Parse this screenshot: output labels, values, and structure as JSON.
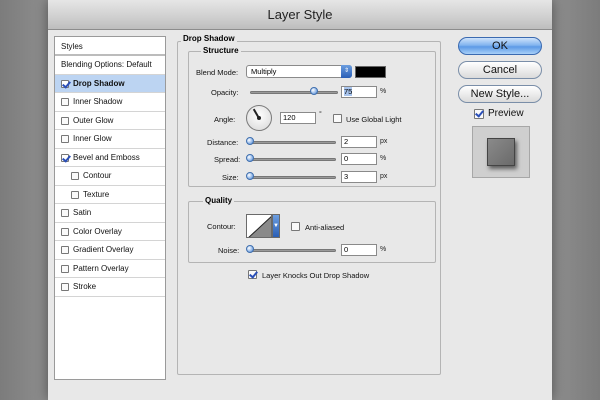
{
  "window": {
    "title": "Layer Style"
  },
  "styles_panel": {
    "header": "Styles",
    "items": [
      {
        "label": "Blending Options: Default",
        "checkbox": false,
        "checked": false,
        "indent": 0,
        "selected": false
      },
      {
        "label": "Drop Shadow",
        "checkbox": true,
        "checked": true,
        "indent": 0,
        "selected": true
      },
      {
        "label": "Inner Shadow",
        "checkbox": true,
        "checked": false,
        "indent": 0,
        "selected": false
      },
      {
        "label": "Outer Glow",
        "checkbox": true,
        "checked": false,
        "indent": 0,
        "selected": false
      },
      {
        "label": "Inner Glow",
        "checkbox": true,
        "checked": false,
        "indent": 0,
        "selected": false
      },
      {
        "label": "Bevel and Emboss",
        "checkbox": true,
        "checked": true,
        "indent": 0,
        "selected": false
      },
      {
        "label": "Contour",
        "checkbox": true,
        "checked": false,
        "indent": 1,
        "selected": false
      },
      {
        "label": "Texture",
        "checkbox": true,
        "checked": false,
        "indent": 1,
        "selected": false
      },
      {
        "label": "Satin",
        "checkbox": true,
        "checked": false,
        "indent": 0,
        "selected": false
      },
      {
        "label": "Color Overlay",
        "checkbox": true,
        "checked": false,
        "indent": 0,
        "selected": false
      },
      {
        "label": "Gradient Overlay",
        "checkbox": true,
        "checked": false,
        "indent": 0,
        "selected": false
      },
      {
        "label": "Pattern Overlay",
        "checkbox": true,
        "checked": false,
        "indent": 0,
        "selected": false
      },
      {
        "label": "Stroke",
        "checkbox": true,
        "checked": false,
        "indent": 0,
        "selected": false
      }
    ]
  },
  "drop_shadow": {
    "section_title": "Drop Shadow",
    "structure": {
      "title": "Structure",
      "blend_mode_label": "Blend Mode:",
      "blend_mode_value": "Multiply",
      "shadow_color": "#000000",
      "opacity_label": "Opacity:",
      "opacity_value": "75",
      "opacity_unit": "%",
      "opacity_fraction": 0.75,
      "angle_label": "Angle:",
      "angle_value": "120",
      "angle_unit": "°",
      "use_global_light_label": "Use Global Light",
      "use_global_light_checked": false,
      "distance_label": "Distance:",
      "distance_value": "2",
      "distance_unit": "px",
      "spread_label": "Spread:",
      "spread_value": "0",
      "spread_unit": "%",
      "size_label": "Size:",
      "size_value": "3",
      "size_unit": "px"
    },
    "quality": {
      "title": "Quality",
      "contour_label": "Contour:",
      "anti_aliased_label": "Anti-aliased",
      "anti_aliased_checked": false,
      "noise_label": "Noise:",
      "noise_value": "0",
      "noise_unit": "%"
    },
    "knocks_out_label": "Layer Knocks Out Drop Shadow",
    "knocks_out_checked": true
  },
  "buttons": {
    "ok": "OK",
    "cancel": "Cancel",
    "new_style": "New Style...",
    "preview_label": "Preview",
    "preview_checked": true
  },
  "colors": {
    "selection": "#bcd4f2",
    "accent_blue": "#5d9ae6",
    "window_bg": "#e8e8e8"
  }
}
